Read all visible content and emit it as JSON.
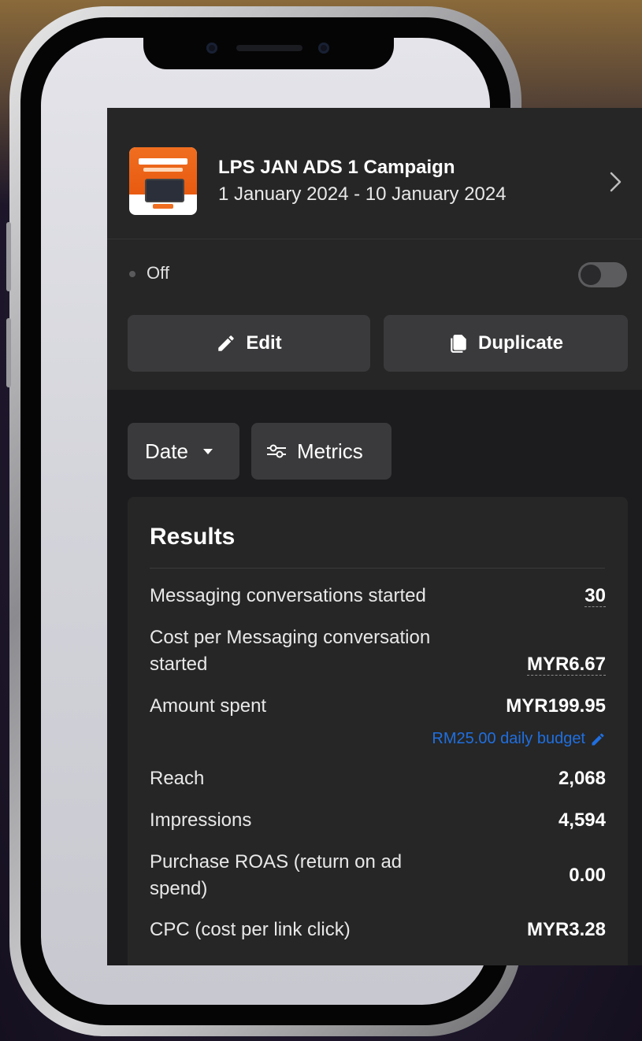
{
  "campaign": {
    "name": "LPS JAN ADS 1 Campaign",
    "dates": "1 January 2024 - 10 January 2024",
    "thumbnail_icon": "campaign-thumbnail"
  },
  "status": {
    "label": "Off",
    "toggle_on": false
  },
  "actions": {
    "edit_label": "Edit",
    "duplicate_label": "Duplicate"
  },
  "filters": {
    "date_label": "Date",
    "metrics_label": "Metrics"
  },
  "results": {
    "title": "Results",
    "rows": [
      {
        "label": "Messaging conversations started",
        "value": "30"
      },
      {
        "label_line1": "Cost per Messaging conversation",
        "label_line2": "started",
        "value": "MYR6.67"
      },
      {
        "label": "Amount spent",
        "value": "MYR199.95",
        "budget_link": "RM25.00 daily budget"
      },
      {
        "label": "Reach",
        "value": "2,068"
      },
      {
        "label": "Impressions",
        "value": "4,594"
      },
      {
        "label_line1": "Purchase ROAS (return on ad",
        "label_line2": "spend)",
        "value": "0.00"
      },
      {
        "label": "CPC (cost per link click)",
        "value": "MYR3.28"
      }
    ]
  },
  "colors": {
    "panel_bg": "#1c1c1e",
    "card_bg": "#262626",
    "button_bg": "#3a3a3c",
    "link_blue": "#1f6fe0"
  }
}
